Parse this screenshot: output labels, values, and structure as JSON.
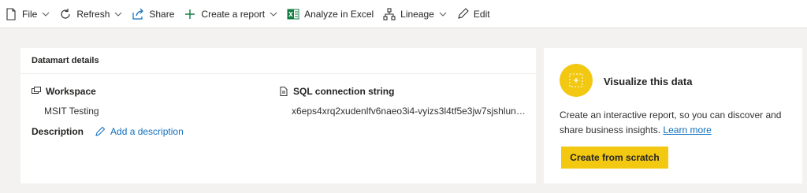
{
  "toolbar": {
    "file": "File",
    "refresh": "Refresh",
    "share": "Share",
    "create_report": "Create a report",
    "analyze_excel": "Analyze in Excel",
    "lineage": "Lineage",
    "edit": "Edit"
  },
  "details": {
    "title": "Datamart details",
    "workspace_label": "Workspace",
    "workspace_value": "MSIT Testing",
    "sql_label": "SQL connection string",
    "sql_value": "x6eps4xrq2xudenlfv6naeo3i4-vyizs3l4tf5e3jw7sjshlune5...",
    "description_label": "Description",
    "add_description": "Add a description"
  },
  "visualize": {
    "title": "Visualize this data",
    "text": "Create an interactive report, so you can discover and share business insights.",
    "learn_more": "Learn more",
    "button": "Create from scratch"
  },
  "colors": {
    "accent": "#f2c811",
    "link": "#106ebe",
    "excel_green": "#107c41"
  }
}
